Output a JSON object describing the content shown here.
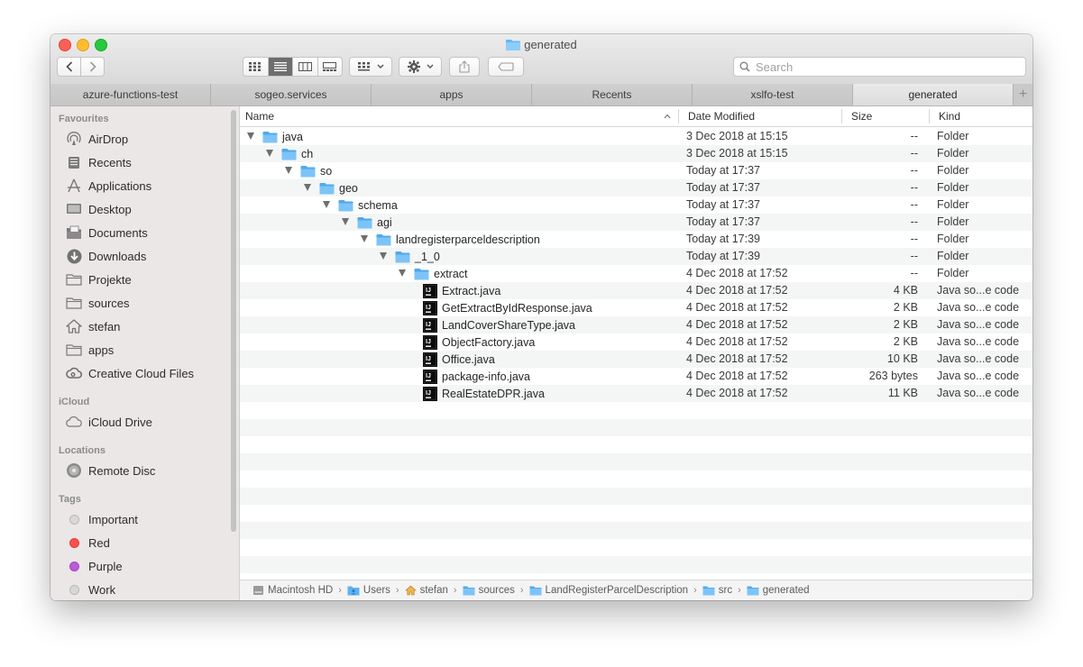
{
  "window": {
    "title": "generated",
    "search_placeholder": "Search"
  },
  "tabs": [
    {
      "label": "azure-functions-test",
      "active": false
    },
    {
      "label": "sogeo.services",
      "active": false
    },
    {
      "label": "apps",
      "active": false
    },
    {
      "label": "Recents",
      "active": false
    },
    {
      "label": "xslfo-test",
      "active": false
    },
    {
      "label": "generated",
      "active": true
    }
  ],
  "sidebar": {
    "favourites_header": "Favourites",
    "favourites": [
      {
        "label": "AirDrop",
        "icon": "airdrop-icon"
      },
      {
        "label": "Recents",
        "icon": "recents-icon"
      },
      {
        "label": "Applications",
        "icon": "applications-icon"
      },
      {
        "label": "Desktop",
        "icon": "desktop-icon"
      },
      {
        "label": "Documents",
        "icon": "documents-icon"
      },
      {
        "label": "Downloads",
        "icon": "downloads-icon"
      },
      {
        "label": "Projekte",
        "icon": "folder-icon"
      },
      {
        "label": "sources",
        "icon": "folder-icon"
      },
      {
        "label": "stefan",
        "icon": "home-icon"
      },
      {
        "label": "apps",
        "icon": "folder-icon"
      },
      {
        "label": "Creative Cloud Files",
        "icon": "creative-cloud-icon"
      }
    ],
    "icloud_header": "iCloud",
    "icloud": [
      {
        "label": "iCloud Drive",
        "icon": "cloud-icon"
      }
    ],
    "locations_header": "Locations",
    "locations": [
      {
        "label": "Remote Disc",
        "icon": "disc-icon"
      }
    ],
    "tags_header": "Tags",
    "tags": [
      {
        "label": "Important",
        "color": "#d8d8d8"
      },
      {
        "label": "Red",
        "color": "#fc4f4c"
      },
      {
        "label": "Purple",
        "color": "#bc5bd6"
      },
      {
        "label": "Work",
        "color": "#d8d8d8"
      }
    ]
  },
  "columns": {
    "name": "Name",
    "date": "Date Modified",
    "size": "Size",
    "kind": "Kind"
  },
  "rows": [
    {
      "name": "java",
      "depth": 0,
      "type": "folder",
      "date": "3 Dec 2018 at 15:15",
      "size": "--",
      "kind": "Folder"
    },
    {
      "name": "ch",
      "depth": 1,
      "type": "folder",
      "date": "3 Dec 2018 at 15:15",
      "size": "--",
      "kind": "Folder"
    },
    {
      "name": "so",
      "depth": 2,
      "type": "folder",
      "date": "Today at 17:37",
      "size": "--",
      "kind": "Folder"
    },
    {
      "name": "geo",
      "depth": 3,
      "type": "folder",
      "date": "Today at 17:37",
      "size": "--",
      "kind": "Folder"
    },
    {
      "name": "schema",
      "depth": 4,
      "type": "folder",
      "date": "Today at 17:37",
      "size": "--",
      "kind": "Folder"
    },
    {
      "name": "agi",
      "depth": 5,
      "type": "folder",
      "date": "Today at 17:37",
      "size": "--",
      "kind": "Folder"
    },
    {
      "name": "landregisterparceldescription",
      "depth": 6,
      "type": "folder",
      "date": "Today at 17:39",
      "size": "--",
      "kind": "Folder"
    },
    {
      "name": "_1_0",
      "depth": 7,
      "type": "folder",
      "date": "Today at 17:39",
      "size": "--",
      "kind": "Folder"
    },
    {
      "name": "extract",
      "depth": 8,
      "type": "folder",
      "date": "4 Dec 2018 at 17:52",
      "size": "--",
      "kind": "Folder"
    },
    {
      "name": "Extract.java",
      "depth": 9,
      "type": "java",
      "date": "4 Dec 2018 at 17:52",
      "size": "4 KB",
      "kind": "Java so...e code"
    },
    {
      "name": "GetExtractByIdResponse.java",
      "depth": 9,
      "type": "java",
      "date": "4 Dec 2018 at 17:52",
      "size": "2 KB",
      "kind": "Java so...e code"
    },
    {
      "name": "LandCoverShareType.java",
      "depth": 9,
      "type": "java",
      "date": "4 Dec 2018 at 17:52",
      "size": "2 KB",
      "kind": "Java so...e code"
    },
    {
      "name": "ObjectFactory.java",
      "depth": 9,
      "type": "java",
      "date": "4 Dec 2018 at 17:52",
      "size": "2 KB",
      "kind": "Java so...e code"
    },
    {
      "name": "Office.java",
      "depth": 9,
      "type": "java",
      "date": "4 Dec 2018 at 17:52",
      "size": "10 KB",
      "kind": "Java so...e code"
    },
    {
      "name": "package-info.java",
      "depth": 9,
      "type": "java",
      "date": "4 Dec 2018 at 17:52",
      "size": "263 bytes",
      "kind": "Java so...e code"
    },
    {
      "name": "RealEstateDPR.java",
      "depth": 9,
      "type": "java",
      "date": "4 Dec 2018 at 17:52",
      "size": "11 KB",
      "kind": "Java so...e code"
    }
  ],
  "pathbar": [
    {
      "label": "Macintosh HD",
      "icon": "hard-drive-icon"
    },
    {
      "label": "Users",
      "icon": "users-folder-icon"
    },
    {
      "label": "stefan",
      "icon": "home-icon"
    },
    {
      "label": "sources",
      "icon": "folder-icon"
    },
    {
      "label": "LandRegisterParcelDescription",
      "icon": "folder-icon"
    },
    {
      "label": "src",
      "icon": "folder-icon"
    },
    {
      "label": "generated",
      "icon": "folder-icon"
    }
  ],
  "colors": {
    "folder_blue": "#5db3f2",
    "selected_view": "#6d6d6d",
    "sidebar_bg": "#eae7e6"
  }
}
